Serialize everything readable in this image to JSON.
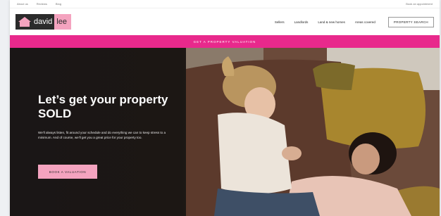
{
  "utility": {
    "links": [
      "About us",
      "Reviews",
      "Blog"
    ],
    "right": [
      "Book an appointment"
    ]
  },
  "header": {
    "logo_part1": "david",
    "logo_part2": "lee",
    "nav": [
      "Sellers",
      "Landlords",
      "Land & new homes",
      "Areas covered"
    ],
    "search_label": "PROPERTY SEARCH"
  },
  "banner": {
    "label": "GET A PROPERTY VALUATION"
  },
  "hero": {
    "title": "Let’s get your property SOLD",
    "body": "We'll always listen, fit around your schedule and do everything we can to keep stress to a minimum. And of course, we'll get you a great price for your property too.",
    "cta": "BOOK A VALUATION"
  },
  "colors": {
    "brand_pink": "#e8298c",
    "light_pink": "#f4a3bf",
    "dark": "#2b2b2b"
  }
}
